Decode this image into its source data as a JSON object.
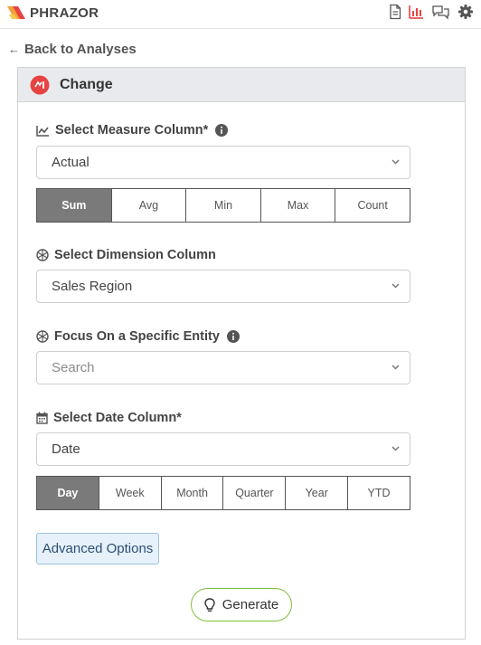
{
  "app": {
    "brand": "PHRAZOR",
    "logo_icon": "phrazor-logo-icon",
    "toolbar_icons": [
      "document-icon",
      "bar-chart-icon",
      "chat-icon",
      "gear-icon"
    ],
    "accent_color": "#e84343"
  },
  "nav": {
    "back_label": "Back to Analyses",
    "back_icon": "arrow-left-icon"
  },
  "card": {
    "title": "Change",
    "icon": "change-icon"
  },
  "measure": {
    "label": "Select Measure Column*",
    "value": "Actual",
    "aggregations": [
      "Sum",
      "Avg",
      "Min",
      "Max",
      "Count"
    ],
    "selected_aggregation": "Sum"
  },
  "dimension": {
    "label": "Select Dimension Column",
    "value": "Sales Region"
  },
  "focus": {
    "label": "Focus On a Specific Entity",
    "placeholder": "Search"
  },
  "date": {
    "label": "Select Date Column*",
    "value": "Date",
    "granularities": [
      "Day",
      "Week",
      "Month",
      "Quarter",
      "Year",
      "YTD"
    ],
    "selected_granularity": "Day"
  },
  "actions": {
    "advanced_label": "Advanced Options",
    "generate_label": "Generate"
  }
}
